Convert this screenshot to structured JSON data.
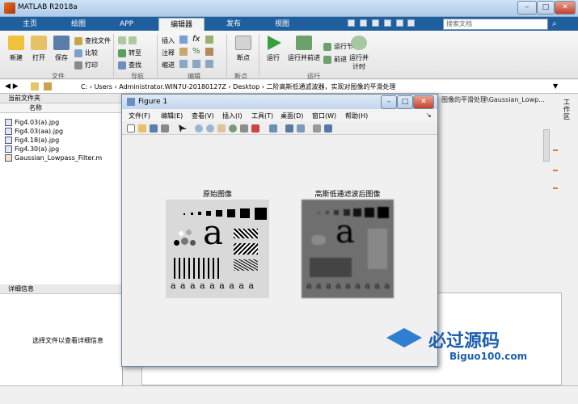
{
  "window": {
    "title": "MATLAB R2018a"
  },
  "ribbon_tabs": [
    "主页",
    "绘图",
    "APP",
    "编辑器",
    "发布",
    "视图"
  ],
  "search": {
    "placeholder": "搜索文档"
  },
  "ribbon": {
    "new": "新建",
    "open": "打开",
    "save": "保存",
    "find_files": "查找文件",
    "compare": "比较",
    "print": "打印",
    "goto": "转至",
    "find": "查找",
    "insert": "插入",
    "comment": "注释",
    "indent": "缩进",
    "breakpoints": "断点",
    "run": "运行",
    "run_advance": "运行并前进",
    "run_section": "运行节",
    "advance": "前进",
    "run_time": "运行并计时",
    "groups": {
      "file": "文件",
      "navigate": "导航",
      "edit": "编辑",
      "breakpoints": "断点",
      "run": "运行"
    }
  },
  "address": {
    "path": "C: › Users › Administrator.WIN7U-20180127Z › Desktop › 二阶高斯低通滤波器，实现对图像的平滑处理"
  },
  "current_folder": {
    "title": "当前文件夹",
    "column": "名称",
    "files": [
      "Fig4.03(a).jpg",
      "Fig4.03(aa).jpg",
      "Fig4.18(a).jpg",
      "Fig4.30(a).jpg",
      "Gaussian_Lowpass_Filter.m"
    ]
  },
  "details": {
    "title": "详细信息",
    "message": "选择文件以查看详细信息"
  },
  "editor_tab_path": "图像的平滑处理\\Gaussian_Lowp...",
  "workspace_label": "工作区",
  "figure": {
    "title": "Figure 1",
    "menu": [
      "文件(F)",
      "编辑(E)",
      "查看(V)",
      "插入(I)",
      "工具(T)",
      "桌面(D)",
      "窗口(W)",
      "帮助(H)"
    ],
    "left_title": "原始图像",
    "right_title": "高斯低通滤波后图像",
    "image_letters": "a a a a a a a a a"
  },
  "watermark": {
    "text": "必过源码",
    "url": "Biguo100.com"
  }
}
